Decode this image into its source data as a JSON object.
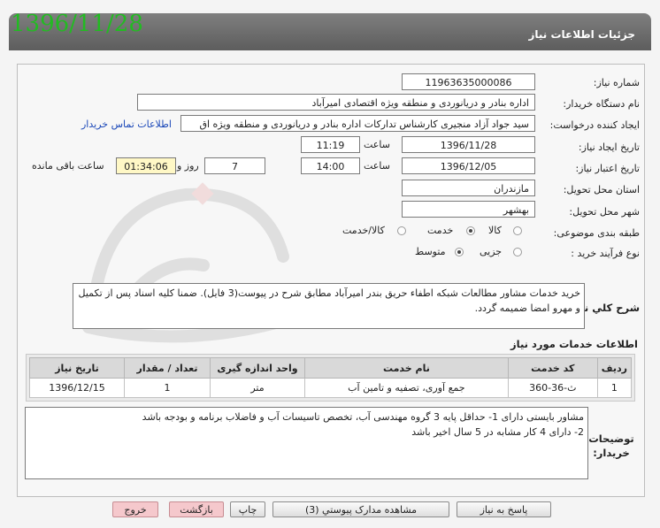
{
  "header": {
    "title": "جزئیات اطلاعات نیاز",
    "date_stamp": "1396/11/28"
  },
  "fields": {
    "need_number": {
      "label": "شماره نیاز:",
      "value": "11963635000086"
    },
    "buyer_org": {
      "label": "نام دستگاه خریدار:",
      "value": "اداره بنادر و دریانوردی و منطقه ویژه اقتصادی امیرآباد"
    },
    "requester": {
      "label": "ایجاد کننده درخواست:",
      "value": "سید جواد  آزاد منجیری کارشناس تدارکات اداره بنادر و دریانوردی و منطقه ویژه اق",
      "contact_link": "اطلاعات تماس خریدار"
    },
    "creation_date": {
      "label": "تاریخ ایجاد نیاز:",
      "date": "1396/11/28",
      "time_label": "ساعت",
      "time": "11:19"
    },
    "validity_date": {
      "label": "تاریخ اعتبار نیاز:",
      "date": "1396/12/05",
      "time_label": "ساعت",
      "time": "14:00",
      "days": "7",
      "days_label": "روز و",
      "remaining": "01:34:06",
      "remaining_label": "ساعت باقی مانده"
    },
    "province": {
      "label": "استان محل تحویل:",
      "value": "مازندران"
    },
    "city": {
      "label": "شهر محل تحویل:",
      "value": "بهشهر"
    },
    "category": {
      "label": "طبقه بندی موضوعی:",
      "options": [
        "کالا",
        "خدمت",
        "کالا/خدمت"
      ],
      "selected": "خدمت"
    },
    "process_type": {
      "label": "نوع فرآیند خرید :",
      "options": [
        "جزیی",
        "متوسط"
      ],
      "selected": "متوسط"
    }
  },
  "general_description": {
    "label": "شرح کلي نياز:",
    "text": "خرید خدمات مشاور مطالعات شبکه اطفاء حریق بندر امیرآباد مطابق شرح در پیوست(3 فایل). ضمنا کلیه اسناد پس از تکمیل و مهرو امضا ضمیمه گردد."
  },
  "services": {
    "title": "اطلاعات خدمات مورد نیاز",
    "columns": [
      "ردیف",
      "کد خدمت",
      "نام خدمت",
      "واحد اندازه گیری",
      "تعداد / مقدار",
      "تاریخ نیاز"
    ],
    "rows": [
      [
        "1",
        "ث-36-360",
        "جمع آوری، تصفیه و تامین آب",
        "متر",
        "1",
        "1396/12/15"
      ]
    ]
  },
  "buyer_notes": {
    "label": "توضیحات خریدار:",
    "line1": "مشاور بایستی دارای 1- حداقل پایه 3 گروه مهندسی آب، تخصص تاسیسات آب و فاضلاب برنامه و بودجه باشد",
    "line2": "2- دارای 4 کار مشابه در 5 سال اخیر باشد"
  },
  "buttons": {
    "reply": "پاسخ به نیاز",
    "attachments": "مشاهده مدارک پیوستي (3)",
    "print": "چاپ",
    "back": "بازگشت",
    "exit": "خروج"
  },
  "watermark_name": "hezareh-watermark"
}
